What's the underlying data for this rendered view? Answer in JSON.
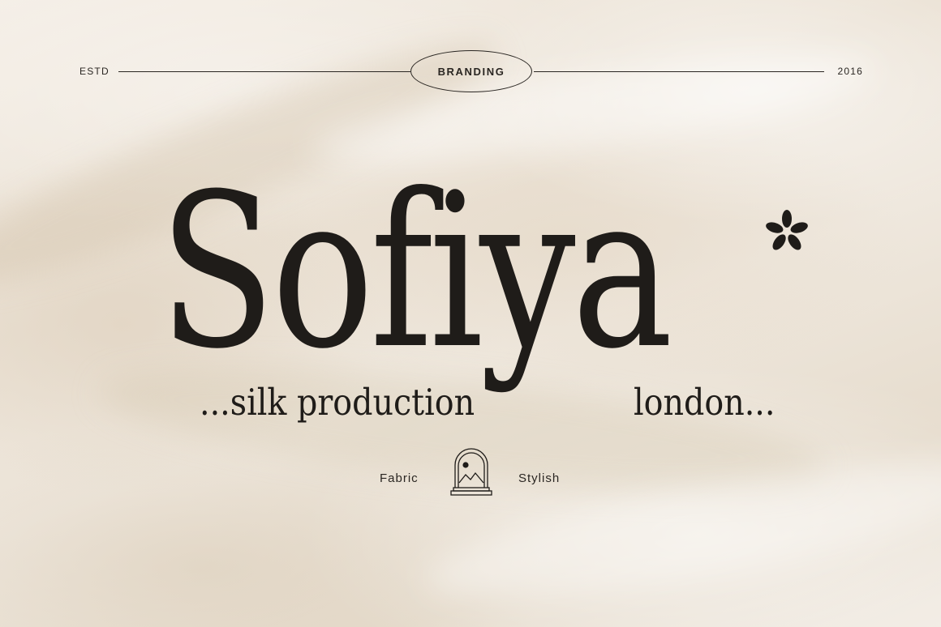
{
  "header": {
    "left_label": "ESTD",
    "badge_label": "BRANDING",
    "right_label": "2016"
  },
  "hero": {
    "title": "Sofiya",
    "tagline_left": "...silk production",
    "tagline_right": "london..."
  },
  "footer": {
    "left_tag": "Fabric",
    "right_tag": "Stylish"
  },
  "icons": {
    "title_mark": "asterisk-flower-icon",
    "center_emblem": "arch-sun-mountains-icon"
  },
  "colors": {
    "ink": "#1f1c19",
    "background": "#efe7dc"
  }
}
